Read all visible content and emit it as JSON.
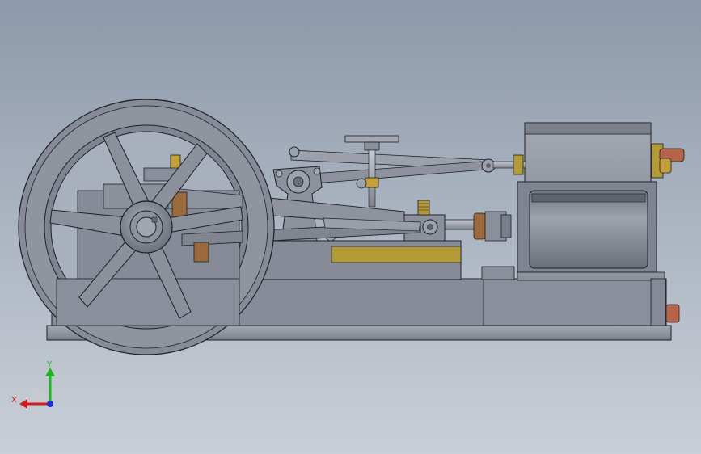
{
  "triad": {
    "y_label": "Y",
    "x_label": "X",
    "colors": {
      "y": "#1fb51f",
      "x": "#d11c1c",
      "z": "#1c2fd1"
    }
  },
  "colors": {
    "background_top": "#8d99aa",
    "background_bottom": "#c9cfd7",
    "metal": "#8a8f9b",
    "metal_light": "#a7abb5",
    "metal_dark": "#6b707b",
    "edge": "#1c1f24",
    "brass": "#c2a03a",
    "copper": "#b5634a",
    "bronze": "#9a6a3c"
  }
}
